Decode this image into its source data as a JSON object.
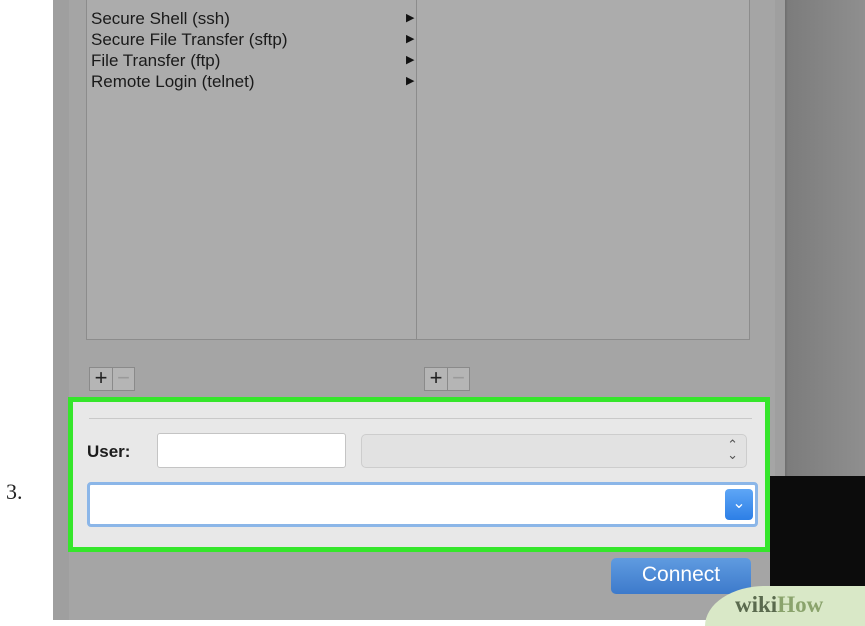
{
  "step_number": "3.",
  "services": [
    {
      "label": "Secure Shell (ssh)"
    },
    {
      "label": "Secure File Transfer (sftp)"
    },
    {
      "label": "File Transfer (ftp)"
    },
    {
      "label": "Remote Login (telnet)"
    }
  ],
  "list_controls": {
    "add": "+",
    "remove": "−"
  },
  "form": {
    "user_label": "User:",
    "user_value": "",
    "user_select_value": "",
    "server_value": "",
    "highlight_color": "#35e62b"
  },
  "connect_label": "Connect",
  "watermark": {
    "wiki": "wiki",
    "how": "How"
  }
}
